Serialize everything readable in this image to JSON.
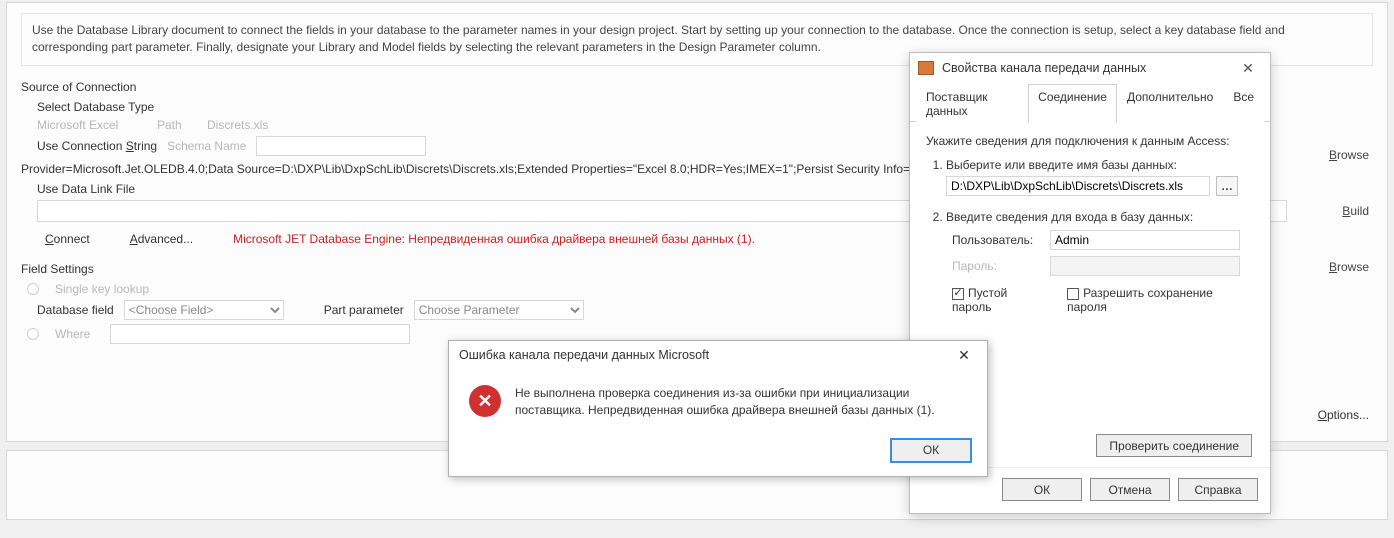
{
  "intro": "Use the Database Library document to connect the fields in your database to the parameter names in your design project. Start by setting up your connection to the database. Once the connection is setup, select a key database field and corresponding part parameter. Finally, designate your Library and Model fields by selecting the relevant parameters in the Design Parameter column.",
  "source": {
    "heading": "Source of Connection",
    "select_db_type": "Select Database Type",
    "ms_excel": "Microsoft Excel",
    "path_label": "Path",
    "path_value": "Discrets.xls",
    "use_conn_string_pre": "Use Connection ",
    "use_conn_string_u": "S",
    "use_conn_string_post": "tring",
    "schema_name": "Schema Name",
    "conn_string": "Provider=Microsoft.Jet.OLEDB.4.0;Data Source=D:\\DXP\\Lib\\DxpSchLib\\Discrets\\Discrets.xls;Extended Properties=\"Excel 8.0;HDR=Yes;IMEX=1\";Persist Security Info=False",
    "use_data_link": "Use Data Link File",
    "connect_u": "C",
    "connect_post": "onnect",
    "advanced": "Advanced...",
    "error": "Microsoft JET Database Engine: Непредвиденная ошибка драйвера внешней базы данных (1)."
  },
  "field_settings": {
    "heading": "Field Settings",
    "single_key": "Single key lookup",
    "db_field_label": "Database field",
    "db_field_placeholder": "<Choose Field>",
    "part_param_label": "Part parameter",
    "part_param_placeholder": "Choose Parameter",
    "where": "Where"
  },
  "right": {
    "browse_pre": "B",
    "browse_post": "rowse",
    "build_pre": "B",
    "build_post": "uild",
    "browse2_pre": "B",
    "browse2_post": "rowse",
    "options_pre": "O",
    "options_post": "ptions..."
  },
  "err_dialog": {
    "title": "Ошибка канала передачи данных Microsoft",
    "message": "Не выполнена проверка соединения из-за ошибки при инициализации поставщика. Непредвиденная ошибка драйвера внешней базы данных (1).",
    "ok": "ОК"
  },
  "props_dialog": {
    "title": "Свойства канала передачи данных",
    "tabs": {
      "provider": "Поставщик данных",
      "connection": "Соединение",
      "extra": "Дополнительно",
      "all": "Все"
    },
    "intro": "Укажите сведения для подключения к данным Access:",
    "step1": "Выберите или введите имя базы данных:",
    "db_path": "D:\\DXP\\Lib\\DxpSchLib\\Discrets\\Discrets.xls",
    "step2": "Введите сведения для входа в базу данных:",
    "user_label": "Пользователь:",
    "user_value": "Admin",
    "pass_label": "Пароль:",
    "empty_pass": "Пустой пароль",
    "save_pass": "Разрешить сохранение пароля",
    "test": "Проверить соединение",
    "ok": "ОК",
    "cancel": "Отмена",
    "help": "Справка"
  }
}
